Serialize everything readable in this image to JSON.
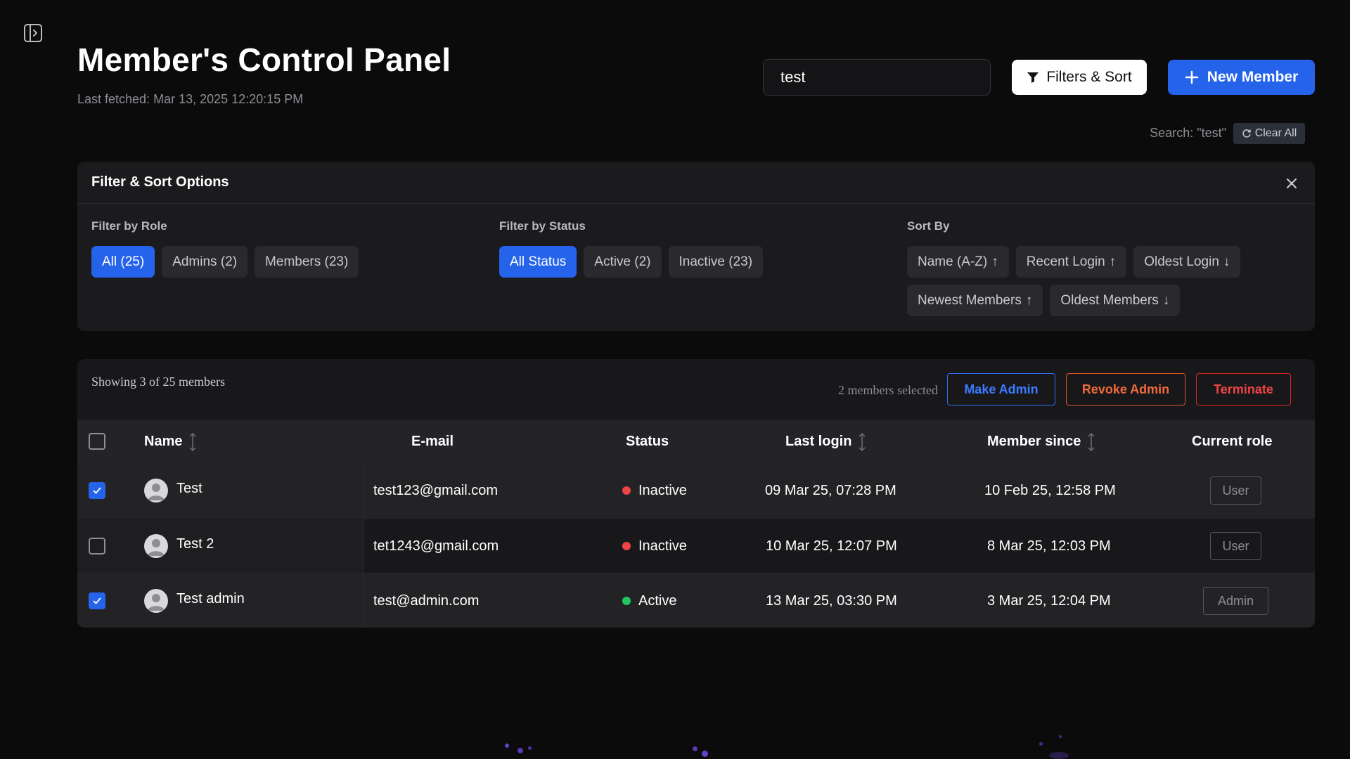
{
  "header": {
    "title": "Member's Control Panel",
    "last_fetched": "Last fetched: Mar 13, 2025 12:20:15 PM"
  },
  "search": {
    "value": "test",
    "summary": "Search: \"test\"",
    "clear_all_label": "Clear All"
  },
  "toolbar": {
    "filters_label": "Filters & Sort",
    "new_member_label": "New Member"
  },
  "filter_panel": {
    "title": "Filter & Sort Options",
    "role": {
      "title": "Filter by Role",
      "options": [
        "All (25)",
        "Admins (2)",
        "Members (23)"
      ],
      "selected": "All (25)"
    },
    "status": {
      "title": "Filter by Status",
      "options": [
        "All Status",
        "Active (2)",
        "Inactive (23)"
      ],
      "selected": "All Status"
    },
    "sort": {
      "title": "Sort By",
      "options": [
        {
          "label": "Name (A-Z)",
          "arrow": "↑"
        },
        {
          "label": "Recent Login",
          "arrow": "↑"
        },
        {
          "label": "Oldest Login",
          "arrow": "↓"
        },
        {
          "label": "Newest Members",
          "arrow": "↑"
        },
        {
          "label": "Oldest Members",
          "arrow": "↓"
        }
      ]
    }
  },
  "table": {
    "showing": "Showing 3 of 25 members",
    "selected_count": "2 members selected",
    "actions": {
      "make_admin": "Make Admin",
      "revoke_admin": "Revoke Admin",
      "terminate": "Terminate"
    },
    "columns": {
      "name": "Name",
      "email": "E-mail",
      "status": "Status",
      "last_login": "Last login",
      "member_since": "Member since",
      "current_role": "Current role"
    },
    "rows": [
      {
        "checked": true,
        "name": "Test",
        "email": "test123@gmail.com",
        "status": "Inactive",
        "status_color": "#ef4444",
        "last_login": "09 Mar 25, 07:28 PM",
        "member_since": "10 Feb 25, 12:58 PM",
        "role": "User"
      },
      {
        "checked": false,
        "name": "Test 2",
        "email": "tet1243@gmail.com",
        "status": "Inactive",
        "status_color": "#ef4444",
        "last_login": "10 Mar 25, 12:07 PM",
        "member_since": "8 Mar 25, 12:03 PM",
        "role": "User"
      },
      {
        "checked": true,
        "name": "Test admin",
        "email": "test@admin.com",
        "status": "Active",
        "status_color": "#22c55e",
        "last_login": "13 Mar 25, 03:30 PM",
        "member_since": "3 Mar 25, 12:04 PM",
        "role": "Admin"
      }
    ]
  },
  "colors": {
    "accent": "#2563eb",
    "danger": "#ef4444",
    "warning": "#f06a3a",
    "success": "#22c55e"
  }
}
